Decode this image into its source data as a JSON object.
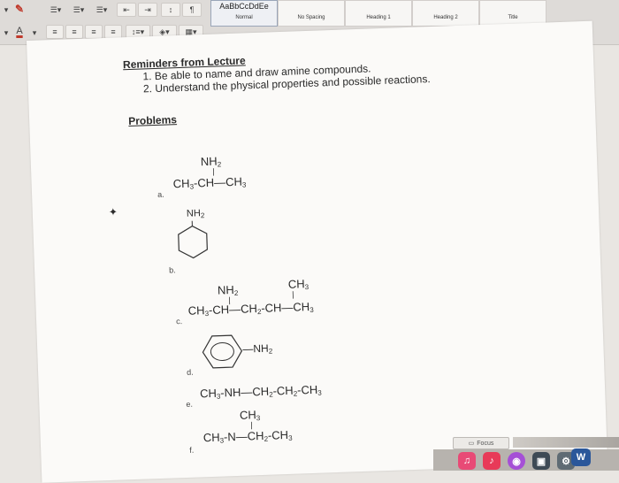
{
  "ribbon": {
    "font_color_letter": "A",
    "styles": [
      {
        "sample": "AaBbCcDdEe",
        "name": "Normal"
      },
      {
        "sample": "",
        "name": "No Spacing"
      },
      {
        "sample": "",
        "name": "Heading 1"
      },
      {
        "sample": "",
        "name": "Heading 2"
      },
      {
        "sample": "",
        "name": "Title"
      }
    ]
  },
  "document": {
    "heading": "Reminders from Lecture",
    "reminders": [
      "1.  Be able to name and draw amine compounds.",
      "2.  Understand the physical properties and possible reactions."
    ],
    "problems_heading": "Problems",
    "items": {
      "a": {
        "label": "a.",
        "top": "NH",
        "main": "CH -CH—CH"
      },
      "b": {
        "label": "b.",
        "top": "NH"
      },
      "c": {
        "label": "c.",
        "top_left": "NH",
        "top_right": "CH",
        "main": "CH -CH—CH -CH—CH"
      },
      "d": {
        "label": "d.",
        "sub": "—NH"
      },
      "e": {
        "label": "e.",
        "main": "CH -NH—CH -CH -CH"
      },
      "f": {
        "label": "f.",
        "top": "CH",
        "main": "CH -N—CH -CH"
      }
    }
  },
  "dock": {
    "focus_label": "Focus",
    "word_letter": "W"
  }
}
